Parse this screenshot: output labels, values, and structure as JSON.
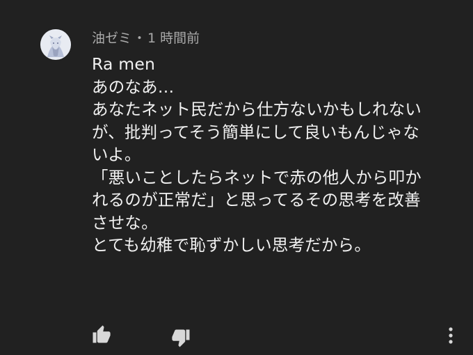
{
  "comment": {
    "author": "油ゼミ",
    "separator": "・",
    "time": "1 時間前",
    "lines": [
      "Ra men",
      "あのなあ…",
      "あなたネット民だから仕方ないかもしれない",
      "が、批判ってそう簡単にして良いもんじゃな",
      "いよ。",
      "「悪いことしたらネットで赤の他人から叩か",
      "れるのが正常だ」と思ってるその思考を改善",
      "させな。",
      "とても幼稚で恥ずかしい思考だから。"
    ]
  },
  "icons": {
    "avatar": "avatar-illustration",
    "like": "thumbs-up-icon",
    "dislike": "thumbs-down-icon",
    "more": "more-vertical-icon"
  },
  "colors": {
    "background": "#212121",
    "text": "#f1f1f1",
    "meta": "#aaaaaa",
    "icon": "#d8d8d8"
  }
}
